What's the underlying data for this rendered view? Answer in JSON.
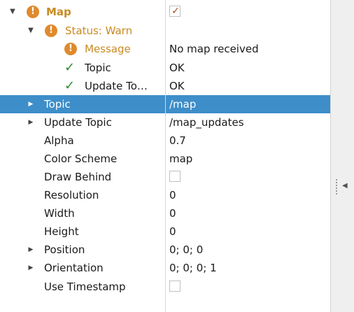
{
  "tree": {
    "map": {
      "label": "Map",
      "checked": true,
      "check_glyph": "✓"
    },
    "status": {
      "label": "Status: Warn"
    },
    "message": {
      "label": "Message",
      "value": "No map received"
    },
    "topic_status": {
      "label": "Topic",
      "value": "OK"
    },
    "update_topic_status": {
      "label": "Update To…",
      "value": "OK"
    },
    "properties": [
      {
        "label": "Topic",
        "value": "/map",
        "expandable": true,
        "selected": true
      },
      {
        "label": "Update Topic",
        "value": "/map_updates",
        "expandable": true
      },
      {
        "label": "Alpha",
        "value": "0.7"
      },
      {
        "label": "Color Scheme",
        "value": "map"
      },
      {
        "label": "Draw Behind",
        "checkbox": true,
        "checked": false
      },
      {
        "label": "Resolution",
        "value": "0"
      },
      {
        "label": "Width",
        "value": "0"
      },
      {
        "label": "Height",
        "value": "0"
      },
      {
        "label": "Position",
        "value": "0; 0; 0",
        "expandable": true
      },
      {
        "label": "Orientation",
        "value": "0; 0; 0; 1",
        "expandable": true
      },
      {
        "label": "Use Timestamp",
        "checkbox": true,
        "checked": false
      }
    ]
  },
  "icons": {
    "warn_glyph": "!",
    "ok_glyph": "✓",
    "expanded_glyph": "▼",
    "collapsed_glyph": "▶",
    "collapse_panel_glyph": "◀"
  },
  "colors": {
    "warning": "#e08a2c",
    "warning_text": "#c98a22",
    "ok": "#2e8b2e",
    "selection": "#3d8ec9"
  }
}
